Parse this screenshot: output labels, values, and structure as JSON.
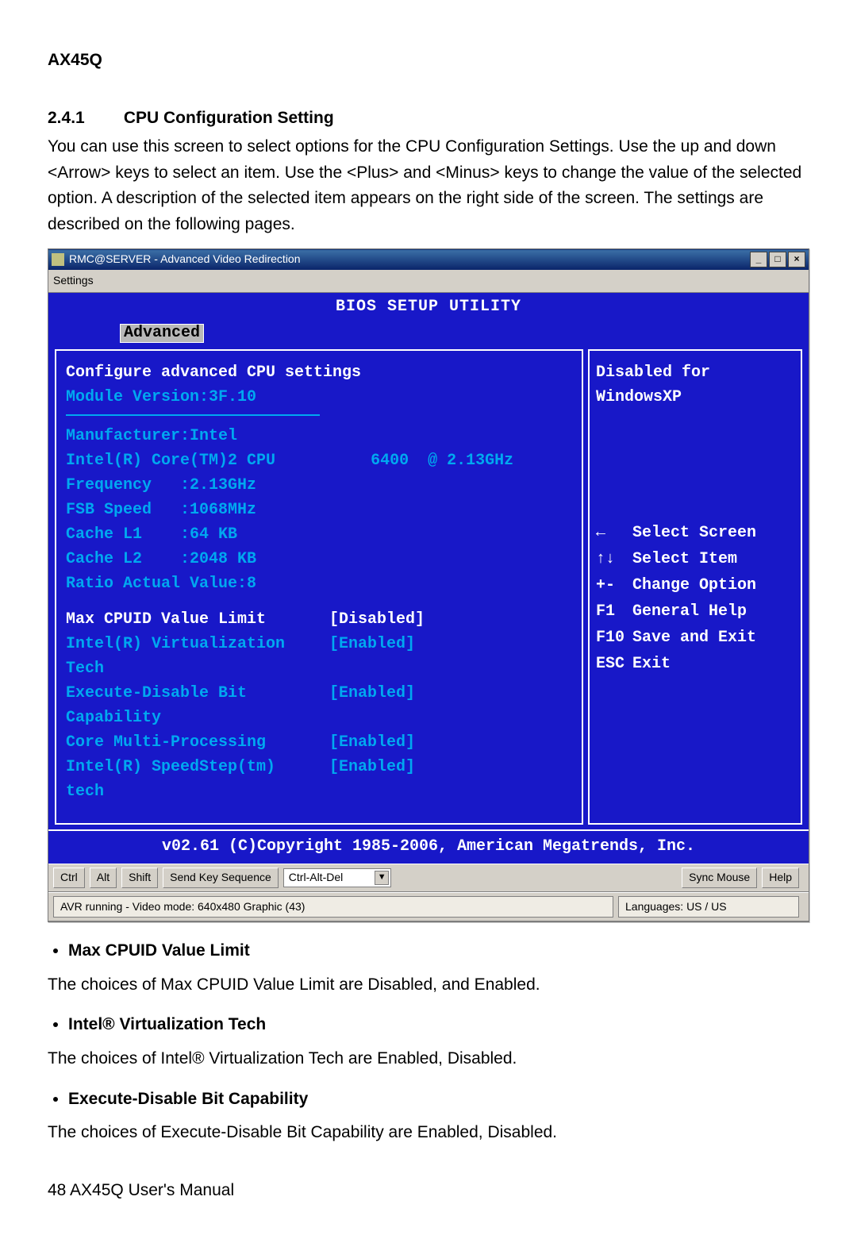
{
  "page": {
    "product": "AX45Q",
    "section_number": "2.4.1",
    "section_title": "CPU Configuration Setting",
    "intro": "You can use this screen to select options for the CPU Configuration Settings. Use the up and down <Arrow> keys to select an item. Use the <Plus> and <Minus> keys to change the value of the selected option. A description of the selected item appears on the right side of the screen. The settings are described on the following pages.",
    "footer": "48 AX45Q User's Manual"
  },
  "window": {
    "title": "RMC@SERVER - Advanced Video Redirection",
    "btn_min": "_",
    "btn_max": "□",
    "btn_close": "×",
    "menu": "Settings",
    "toolbar": {
      "ctrl": "Ctrl",
      "alt": "Alt",
      "shift": "Shift",
      "send_key": "Send Key Sequence",
      "combo_value": "Ctrl-Alt-Del",
      "sync_mouse": "Sync Mouse",
      "help": "Help"
    },
    "status": {
      "left": "AVR running - Video mode: 640x480 Graphic (43)",
      "right": "Languages: US / US"
    }
  },
  "bios": {
    "utility_title": "BIOS SETUP UTILITY",
    "tab": "Advanced",
    "header1": "Configure advanced CPU settings",
    "header2": "Module Version:3F.10",
    "info": {
      "manufacturer": "Manufacturer:Intel",
      "cpu_line": "Intel(R) Core(TM)2 CPU          6400  @ 2.13GHz",
      "frequency": "Frequency   :2.13GHz",
      "fsb": "FSB Speed   :1068MHz",
      "l1": "Cache L1    :64 KB",
      "l2": "Cache L2    :2048 KB",
      "ratio": "Ratio Actual Value:8"
    },
    "options": [
      {
        "name": "Max CPUID Value Limit",
        "value": "[Disabled]",
        "selected": true
      },
      {
        "name": "Intel(R) Virtualization Tech",
        "value": "[Enabled]",
        "selected": false
      },
      {
        "name": "Execute-Disable Bit Capability",
        "value": "[Enabled]",
        "selected": false
      },
      {
        "name": "Core Multi-Processing",
        "value": "[Enabled]",
        "selected": false
      },
      {
        "name": "Intel(R) SpeedStep(tm) tech",
        "value": "[Enabled]",
        "selected": false
      }
    ],
    "help_panel": {
      "context": "Disabled for WindowsXP",
      "keys": [
        {
          "key": "←",
          "desc": "Select Screen"
        },
        {
          "key": "↑↓",
          "desc": "Select Item"
        },
        {
          "key": "+-",
          "desc": "Change Option"
        },
        {
          "key": "F1",
          "desc": "General Help"
        },
        {
          "key": "F10",
          "desc": "Save and Exit"
        },
        {
          "key": "ESC",
          "desc": "Exit"
        }
      ]
    },
    "footer": "v02.61 (C)Copyright 1985-2006, American Megatrends, Inc."
  },
  "post_items": [
    {
      "title": "Max CPUID Value Limit",
      "text": "The choices of Max CPUID Value Limit are Disabled, and Enabled."
    },
    {
      "title": "Intel® Virtualization Tech",
      "text": "The choices of Intel® Virtualization Tech are Enabled, Disabled."
    },
    {
      "title": "Execute-Disable Bit Capability",
      "text": "The choices of Execute-Disable Bit Capability are Enabled, Disabled."
    }
  ]
}
